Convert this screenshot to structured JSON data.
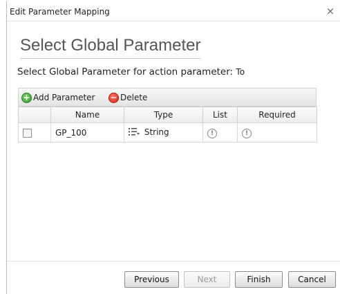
{
  "window": {
    "title": "Edit Parameter Mapping",
    "close_glyph": "×"
  },
  "heading": "Select Global Parameter",
  "subtitle": {
    "text": "Select Global Parameter for action parameter:",
    "param": "To"
  },
  "toolbar": {
    "add_label": "Add Parameter",
    "delete_label": "Delete"
  },
  "table": {
    "columns": [
      "",
      "Name",
      "Type",
      "List",
      "Required"
    ],
    "rows": [
      {
        "checked": false,
        "name": "GP_100",
        "type": "String",
        "list": "info-icon",
        "required": "info-icon"
      }
    ]
  },
  "buttons": {
    "previous": "Previous",
    "next": "Next",
    "finish": "Finish",
    "cancel": "Cancel"
  },
  "colors": {
    "add": "#2f9a27",
    "delete": "#d21f0f",
    "heading": "#555555"
  },
  "icons": {
    "add": "plus-circle-icon",
    "delete": "minus-circle-icon",
    "type": "list-type-icon",
    "info": "info-icon"
  }
}
